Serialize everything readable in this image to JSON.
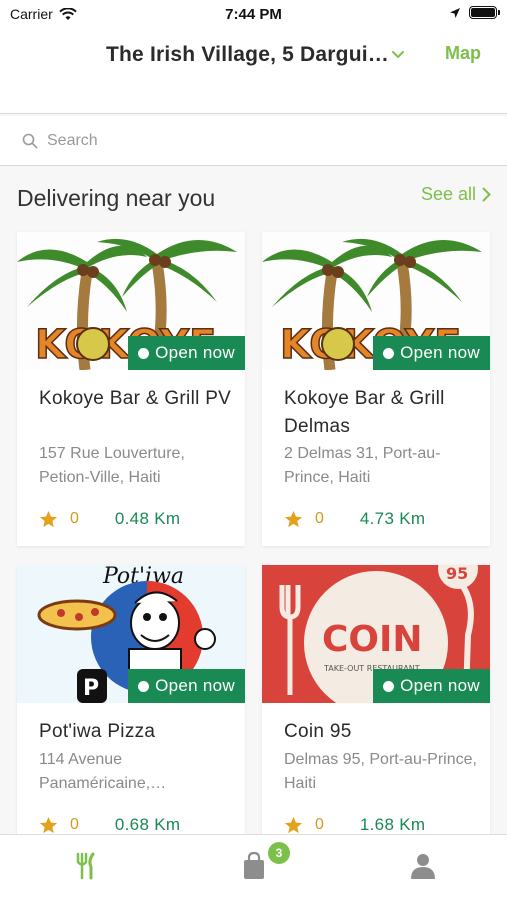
{
  "status_bar": {
    "carrier": "Carrier",
    "time": "7:44 PM"
  },
  "header": {
    "address": "The Irish Village, 5 Darguin…",
    "map_label": "Map"
  },
  "search": {
    "placeholder": "Search"
  },
  "section": {
    "title": "Delivering near you",
    "see_all": "See all"
  },
  "restaurants": [
    {
      "name": "Kokoye Bar & Grill PV",
      "address": "157 Rue Louverture, Petion-Ville, Haiti",
      "status": "Open now",
      "rating": "0",
      "distance": "0.48 Km",
      "image": "kokoye-palm-logo"
    },
    {
      "name": "Kokoye Bar & Grill Delmas",
      "address": "2 Delmas 31, Port-au-Prince, Haiti",
      "status": "Open now",
      "rating": "0",
      "distance": "4.73 Km",
      "image": "kokoye-palm-logo"
    },
    {
      "name": "Pot'iwa Pizza",
      "address": "114 Avenue Panaméricaine,…",
      "status": "Open now",
      "rating": "0",
      "distance": "0.68 Km",
      "image": "potiwa-chef-logo",
      "logo_text": "Pot'iwa",
      "logo_letter": "P"
    },
    {
      "name": "Coin 95",
      "address": "Delmas 95, Port-au-Prince, Haiti",
      "status": "Open now",
      "rating": "0",
      "distance": "1.68 Km",
      "image": "coin95-logo",
      "logo_text": "COIN",
      "logo_sub": "TAKE-OUT RESTAURANT",
      "logo_num": "95"
    }
  ],
  "tabbar": {
    "cart_count": "3",
    "icons": [
      "fork-knife-icon",
      "shopping-bag-icon",
      "user-icon"
    ]
  },
  "colors": {
    "accent": "#7cbf4a",
    "open_green": "#1a8a55",
    "star": "#e2a21a"
  }
}
